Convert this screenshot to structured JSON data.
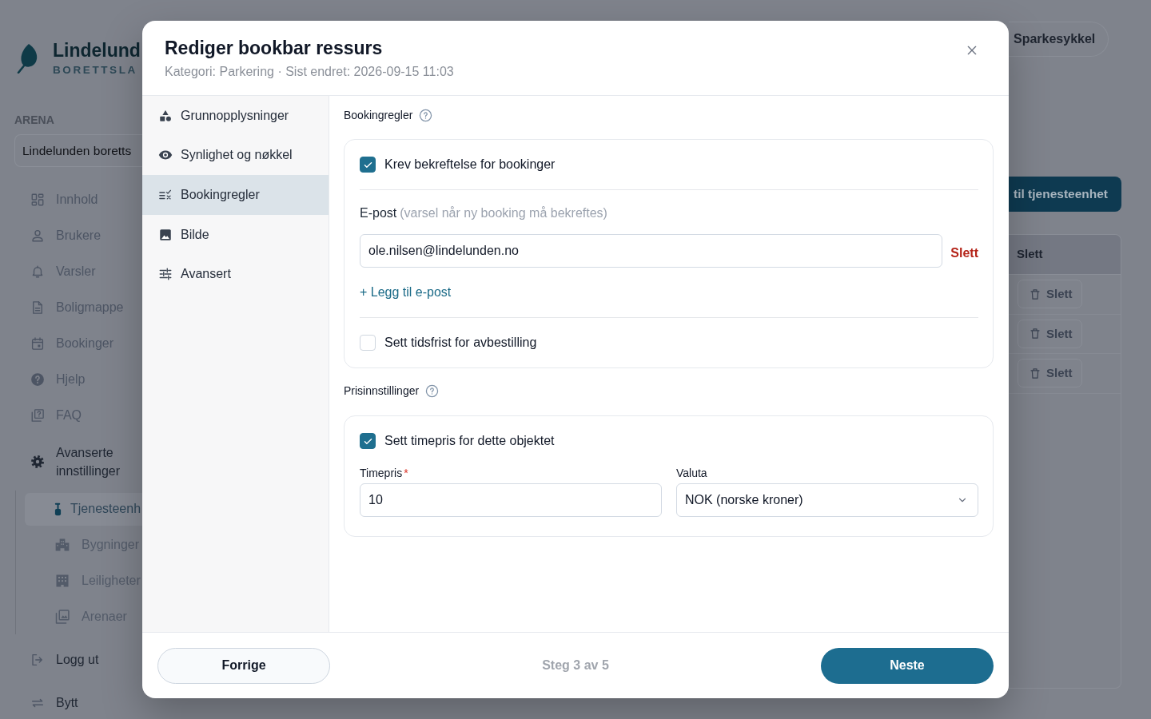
{
  "sidebar": {
    "logo": {
      "name": "Lindelund",
      "tagline": "BORETTSLA"
    },
    "arena": {
      "label": "ARENA",
      "value": "Lindelunden boretts"
    },
    "items": [
      {
        "label": "Innhold",
        "expanded": false
      },
      {
        "label": "Brukere",
        "expanded": false
      },
      {
        "label": "Varsler",
        "expanded": false
      },
      {
        "label": "Boligmappe",
        "expanded": false
      },
      {
        "label": "Bookinger",
        "expanded": false
      },
      {
        "label": "Hjelp",
        "expanded": false
      },
      {
        "label": "FAQ",
        "expanded": false
      },
      {
        "label": "Avanserte innstillinger",
        "expanded": true,
        "children": [
          {
            "label": "Tjenesteenh",
            "selected": true
          },
          {
            "label": "Bygninger",
            "selected": false
          },
          {
            "label": "Leiligheter",
            "selected": false
          },
          {
            "label": "Arenaer",
            "selected": false
          }
        ]
      }
    ],
    "bottom_items": [
      {
        "label": "Logg ut"
      },
      {
        "label": "Bytt"
      }
    ]
  },
  "main": {
    "chip": {
      "label": "Sparkesykkel"
    },
    "primary_button": {
      "label": "til tjenesteenhet"
    },
    "table": {
      "columns": [
        "Slett"
      ],
      "rows": [
        {
          "action": "Slett"
        },
        {
          "action": "Slett"
        },
        {
          "action": "Slett"
        }
      ]
    }
  },
  "dialog": {
    "title": "Rediger bookbar ressurs",
    "subtitle": "Kategori: Parkering · Sist endret: 2026-09-15 11:03",
    "steps": [
      {
        "label": "Grunnopplysninger",
        "selected": false
      },
      {
        "label": "Synlighet og nøkkel",
        "selected": false
      },
      {
        "label": "Bookingregler",
        "selected": true
      },
      {
        "label": "Bilde",
        "selected": false
      },
      {
        "label": "Avansert",
        "selected": false
      }
    ],
    "booking_rules": {
      "heading": "Bookingregler",
      "require_confirmation": {
        "label": "Krev bekreftelse for bookinger",
        "checked": true
      },
      "email": {
        "label": "E-post",
        "hint": "(varsel når ny booking må bekreftes)",
        "entries": [
          {
            "value": "ole.nilsen@lindelunden.no",
            "remove": "Slett"
          }
        ],
        "add_link": "+ Legg til e-post"
      },
      "cancel_deadline": {
        "label": "Sett tidsfrist for avbestilling",
        "checked": false
      }
    },
    "price_settings": {
      "heading": "Prisinnstillinger",
      "hourly_price": {
        "label": "Sett timepris for dette objektet",
        "checked": true
      },
      "price": {
        "label": "Timepris",
        "required_mark": "*",
        "value": "10"
      },
      "currency": {
        "label": "Valuta",
        "value": "NOK (norske kroner)"
      }
    },
    "footer": {
      "back": "Forrige",
      "progress": "Steg 3 av 5",
      "next": "Neste"
    }
  }
}
